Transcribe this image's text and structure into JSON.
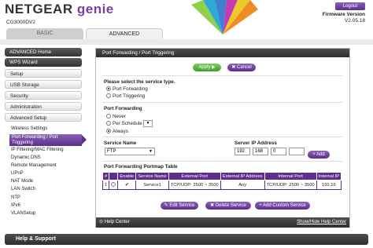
{
  "brand": {
    "name": "NETGEAR",
    "product": "genie",
    "model": "CG3000DV2"
  },
  "header": {
    "logout_label": "Logout",
    "firmware_label": "Firmware Version",
    "firmware_version": "V2.05.18"
  },
  "tabs": {
    "basic": "BASIC",
    "advanced": "ADVANCED"
  },
  "sidebar": {
    "advanced_home": "ADVANCED Home",
    "wps_wizard": "WPS Wizard",
    "setup": "Setup",
    "usb_storage": "USB Storage",
    "security": "Security",
    "administration": "Administration",
    "advanced_setup": "Advanced Setup",
    "sub_items": {
      "wireless_settings": "Wireless Settings",
      "port_forwarding_1": "Port Forwarding / Port",
      "port_forwarding_2": "Triggering",
      "ip_filtering": "IP Filtering/MAC Filtering",
      "dynamic_dns": "Dynamic DNS",
      "remote_management": "Remote Management",
      "upnp": "UPnP",
      "nat_mode": "NAT Mode",
      "lan_switch": "LAN Switch",
      "ntp": "NTP",
      "ipv6": "IPv6",
      "vlan_setup": "VLANSetup"
    }
  },
  "panel": {
    "title": "Port Forwarding / Port Triggering",
    "apply_label": "Apply ▶",
    "cancel_label": "✖ Cancel",
    "service_type_heading": "Please select the service type.",
    "service_type_options": [
      "Port Forwarding",
      "Port Triggering"
    ],
    "service_type_selected": "Port Forwarding",
    "port_forwarding_heading": "Port Forwarding",
    "schedule_options": [
      "Never",
      "Per Schedule",
      "Always"
    ],
    "schedule_selected": "Always",
    "schedule_dropdown": "▼",
    "service_name_label": "Service Name",
    "service_name_value": "FTP",
    "server_ip_label": "Server IP Address",
    "server_ip": [
      "192",
      "168",
      "0",
      ""
    ],
    "add_label": "+ Add",
    "table_title": "Port Forwarding Portmap Table",
    "table_headers": [
      "#",
      "",
      "Enable",
      "Service Name",
      "External Port",
      "External IP Address",
      "Internal Port",
      "Internal IP"
    ],
    "table_rows": [
      [
        "1",
        "",
        "✔",
        "Service1",
        "TCP/UDP: 2500 ~ 3500",
        "Any",
        "TCP/UDP: 2500 ~ 3500",
        "192.16"
      ]
    ],
    "edit_label": "✎ Edit Service",
    "delete_label": "✖ Delete Service",
    "add_custom_label": "+ Add Custom Service",
    "help_center_label": "⊙ Help Center",
    "help_toggle_label": "Show/Hide Help Center"
  },
  "footer": {
    "help_support": "Help & Support"
  },
  "colors": {
    "accent": "#5c2e8e",
    "apply_green": "#3f9d28",
    "dark_bar": "#333333"
  }
}
